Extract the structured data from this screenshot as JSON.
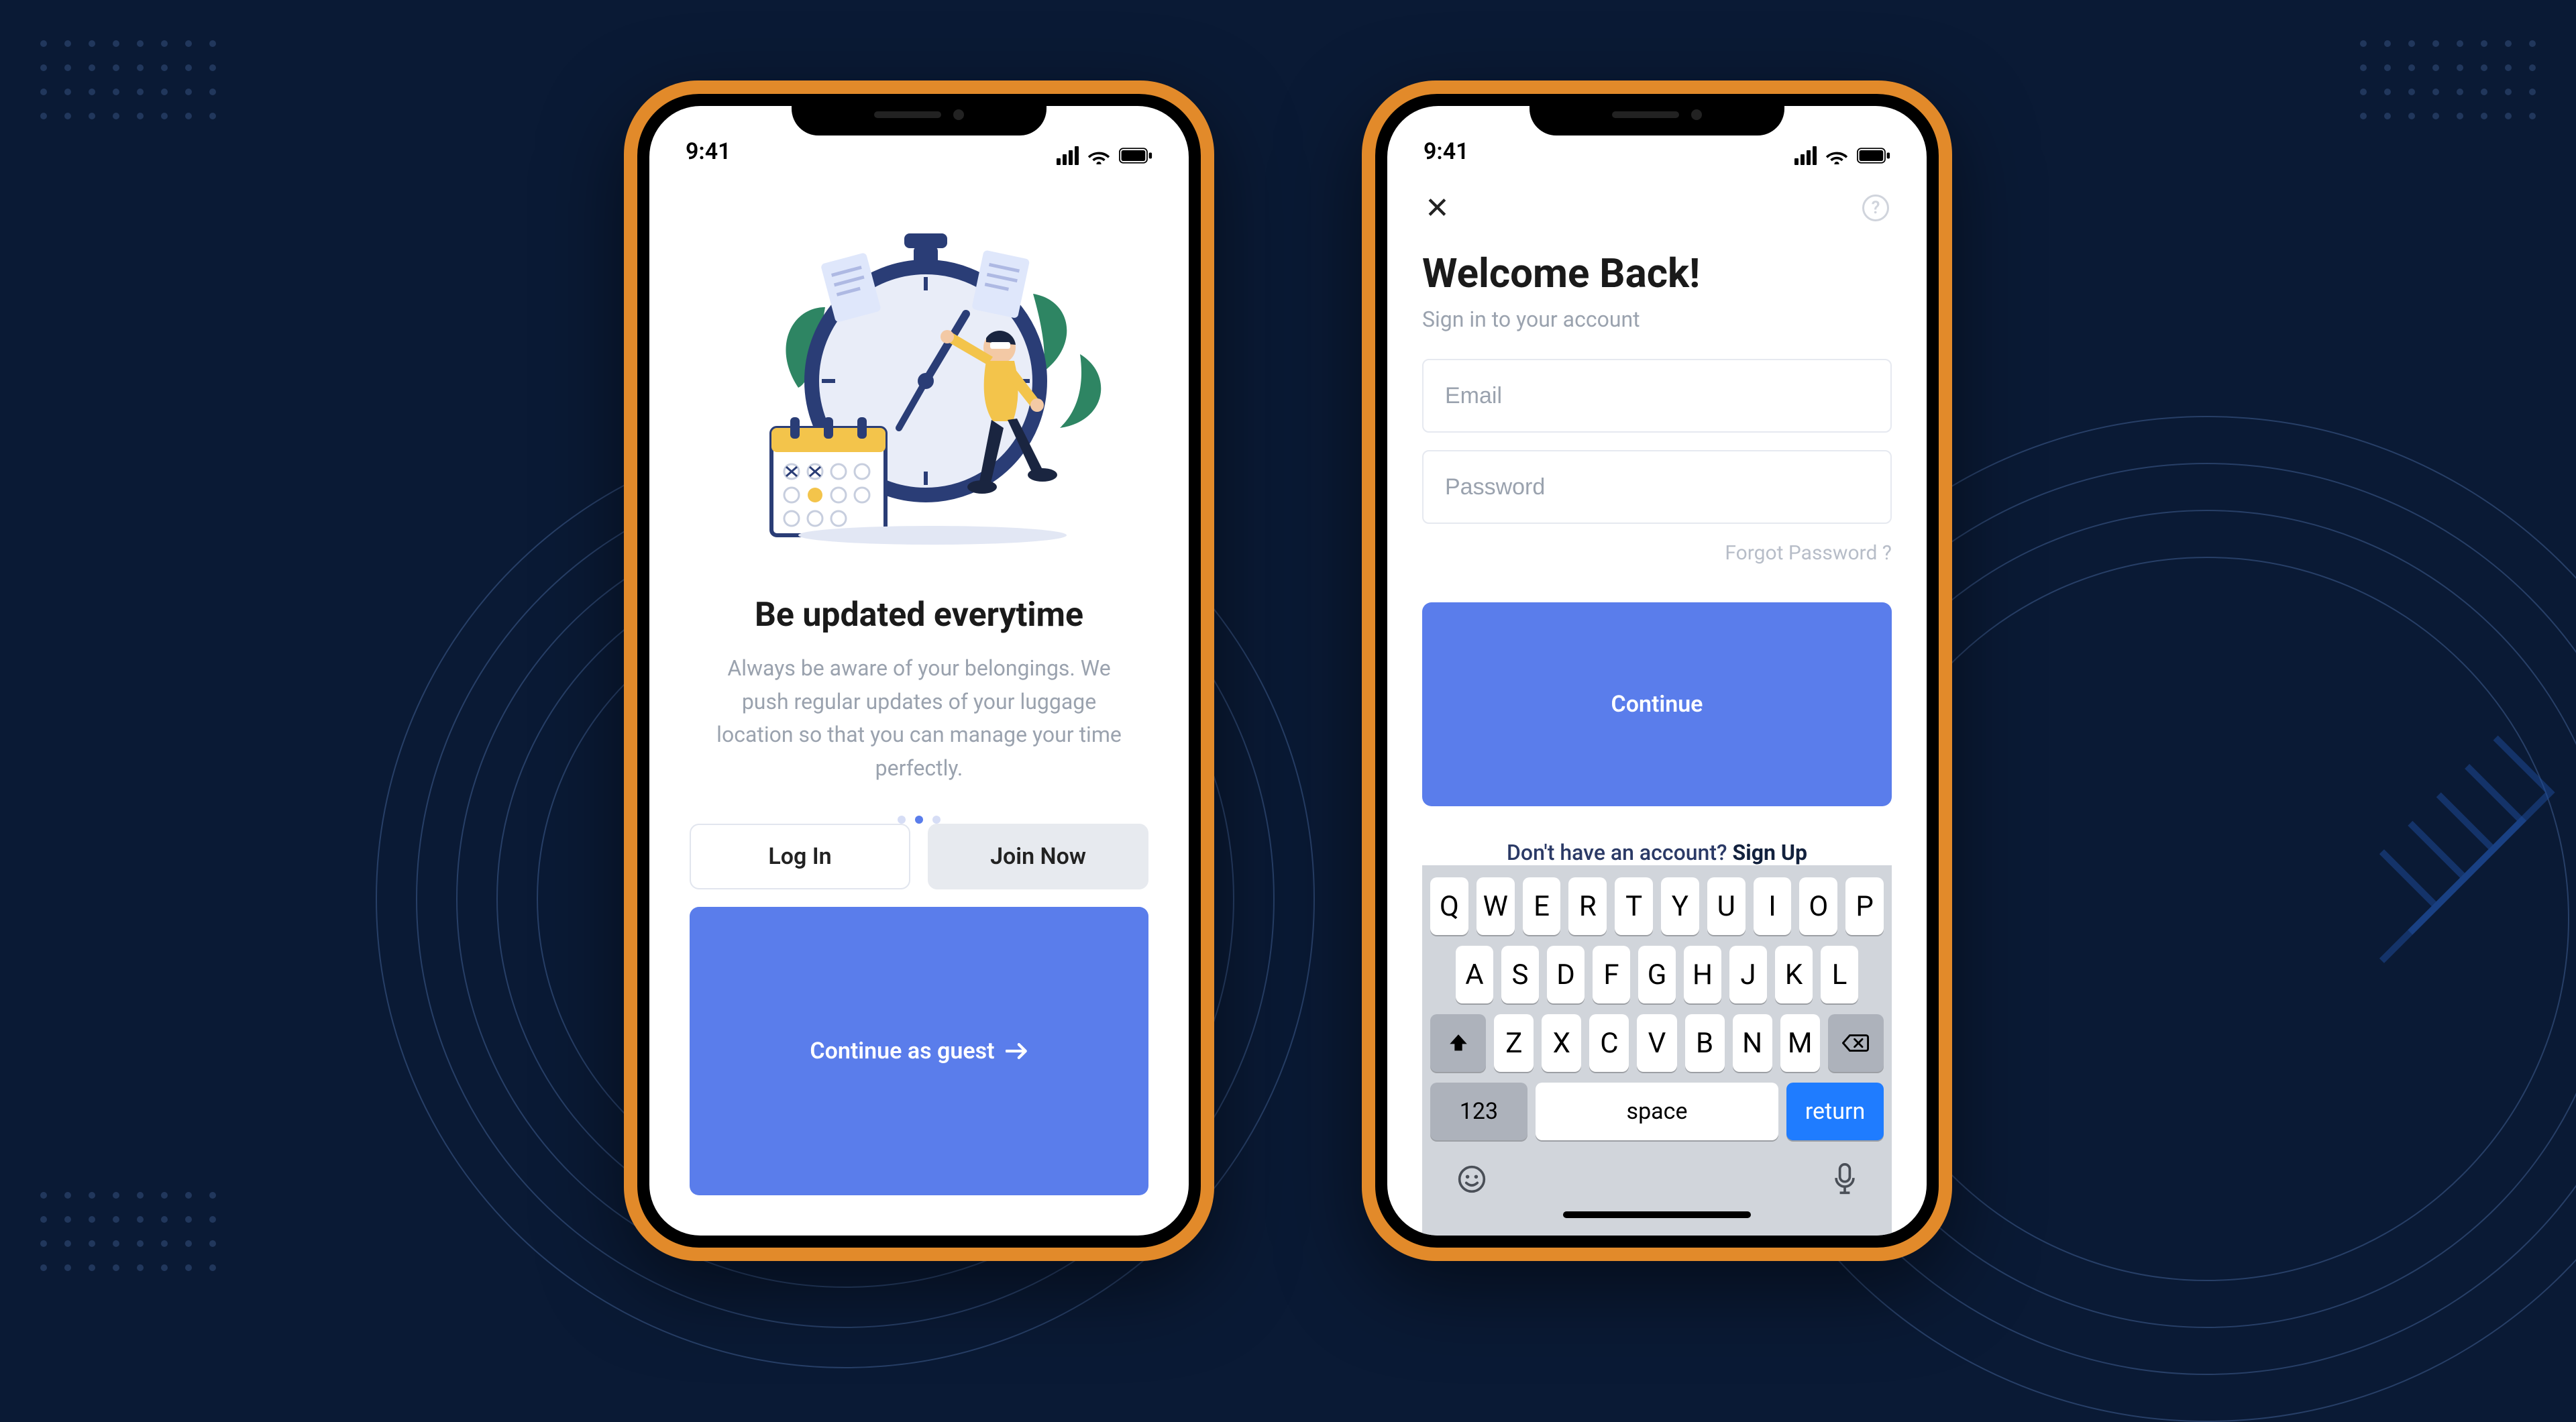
{
  "status": {
    "time": "9:41"
  },
  "onboard": {
    "title": "Be updated everytime",
    "description": "Always be aware of your belongings. We push regular updates of your luggage location so that you can manage your time perfectly.",
    "login_label": "Log In",
    "join_label": "Join Now",
    "guest_label": "Continue as guest",
    "active_page_index": 1,
    "page_count": 3
  },
  "login": {
    "title": "Welcome Back!",
    "subtitle": "Sign in to your account",
    "email_placeholder": "Email",
    "password_placeholder": "Password",
    "forgot_label": "Forgot Password ?",
    "continue_label": "Continue",
    "signup_prefix": "Don't have an account? ",
    "signup_action": "Sign Up"
  },
  "keyboard": {
    "row1": [
      "Q",
      "W",
      "E",
      "R",
      "T",
      "Y",
      "U",
      "I",
      "O",
      "P"
    ],
    "row2": [
      "A",
      "S",
      "D",
      "F",
      "G",
      "H",
      "J",
      "K",
      "L"
    ],
    "row3": [
      "Z",
      "X",
      "C",
      "V",
      "B",
      "N",
      "M"
    ],
    "num_label": "123",
    "space_label": "space",
    "return_label": "return"
  }
}
